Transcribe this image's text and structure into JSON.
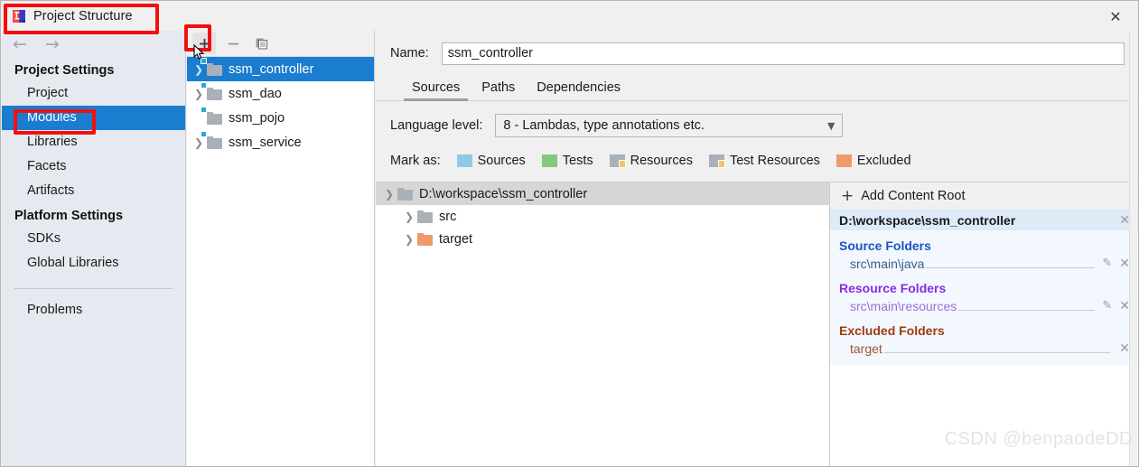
{
  "window": {
    "title": "Project Structure",
    "app_icon": "intellij-idea-icon",
    "close_label": "✕"
  },
  "sidebar": {
    "nav": {
      "back": "←",
      "forward": "→"
    },
    "groups": [
      {
        "label": "Project Settings",
        "items": [
          {
            "label": "Project",
            "selected": false
          },
          {
            "label": "Modules",
            "selected": true
          },
          {
            "label": "Libraries",
            "selected": false
          },
          {
            "label": "Facets",
            "selected": false
          },
          {
            "label": "Artifacts",
            "selected": false
          }
        ]
      },
      {
        "label": "Platform Settings",
        "items": [
          {
            "label": "SDKs",
            "selected": false
          },
          {
            "label": "Global Libraries",
            "selected": false
          }
        ]
      }
    ],
    "problems_label": "Problems"
  },
  "modules_panel": {
    "toolbar": {
      "add_label": "+",
      "remove_label": "–",
      "copy_label": "copy-icon"
    },
    "modules": [
      {
        "name": "ssm_controller",
        "expandable": true,
        "selected": true
      },
      {
        "name": "ssm_dao",
        "expandable": true,
        "selected": false
      },
      {
        "name": "ssm_pojo",
        "expandable": false,
        "selected": false
      },
      {
        "name": "ssm_service",
        "expandable": true,
        "selected": false
      }
    ]
  },
  "detail": {
    "name_label": "Name:",
    "name_value": "ssm_controller",
    "tabs": [
      {
        "label": "Sources",
        "active": true
      },
      {
        "label": "Paths",
        "active": false
      },
      {
        "label": "Dependencies",
        "active": false
      }
    ],
    "language_level_label": "Language level:",
    "language_level_value": "8 - Lambdas, type annotations etc.",
    "mark_as_label": "Mark as:",
    "mark_as_options": [
      {
        "label": "Sources",
        "color": "#8ecae6"
      },
      {
        "label": "Tests",
        "color": "#86c77f"
      },
      {
        "label": "Resources",
        "color": "#a9b0b8"
      },
      {
        "label": "Test Resources",
        "color": "#a9b0b8"
      },
      {
        "label": "Excluded",
        "color": "#ef9a6a"
      }
    ],
    "content_tree": {
      "root": "D:\\workspace\\ssm_controller",
      "children": [
        {
          "label": "src",
          "color": "#a9b0b8"
        },
        {
          "label": "target",
          "color": "#ef9a6a"
        }
      ]
    },
    "info_panel": {
      "add_content_root_label": "Add Content Root",
      "root_path": "D:\\workspace\\ssm_controller",
      "groups": [
        {
          "heading": "Source Folders",
          "kind": "src",
          "entries": [
            {
              "path": "src\\main\\java",
              "editable": true
            }
          ]
        },
        {
          "heading": "Resource Folders",
          "kind": "res",
          "entries": [
            {
              "path": "src\\main\\resources",
              "editable": true
            }
          ]
        },
        {
          "heading": "Excluded Folders",
          "kind": "exc",
          "entries": [
            {
              "path": "target",
              "editable": false
            }
          ]
        }
      ]
    }
  },
  "watermark": "CSDN @benpaodeDD",
  "annotations": {
    "accent_red": "#f30f0f",
    "selection_blue": "#1a7dd0"
  }
}
